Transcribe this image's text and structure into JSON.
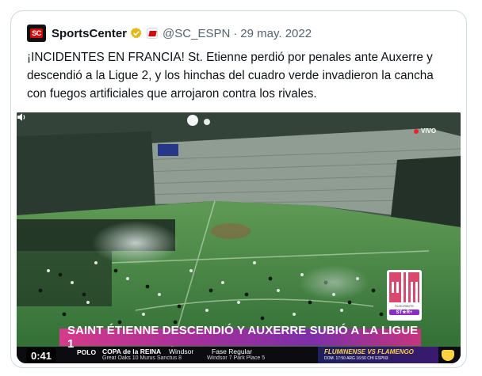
{
  "tweet": {
    "author_name": "SportsCenter",
    "author_avatar_text": "SC",
    "handle": "@SC_ESPN",
    "separator": "·",
    "date": "29 may. 2022",
    "text": "¡INCIDENTES EN FRANCIA! St. Etienne perdió por penales ante Auxerre y descendió a la Ligue 2, y los hinchas del cuadro verde invadieron la cancha con fuegos artificiales que arrojaron contra los rivales.",
    "icons": {
      "verified": "verified-gold-badge-icon",
      "affiliate": "espn-affiliate-icon",
      "speaker": "speaker-icon"
    }
  },
  "video": {
    "live_label": "VIVO",
    "banner_text": "SAINT ÉTIENNE DESCENDIÓ Y AUXERRE SUBIÓ A LA LIGUE 1",
    "qr_caption": "SUSCRIBITE",
    "qr_brand": "ST★R+",
    "elapsed_time": "0:41",
    "ticker": {
      "category": "POLO",
      "event": "COPA de la REINA",
      "team_a_top": "Windsor",
      "team_b_top": "Fase Regular",
      "line2": "Great Oaks 10 Murus Sanctus 8",
      "line2b": "Windsor 7 Park Place 5",
      "promo_top": "BRASIL · PRIMERA DIVISIÓN",
      "promo_title": "FLUMINENSE VS FLAMENGO",
      "promo_bottom": "DOM. 17:50 ARG 16:50 CHI  ESPN3"
    }
  },
  "colors": {
    "brand_red": "#d50a0a",
    "verified_gold": "#e2b719",
    "banner_pink": "#d73a8a",
    "banner_purple": "#7d2fa8",
    "text_primary": "#0f1419",
    "text_secondary": "#536471"
  }
}
